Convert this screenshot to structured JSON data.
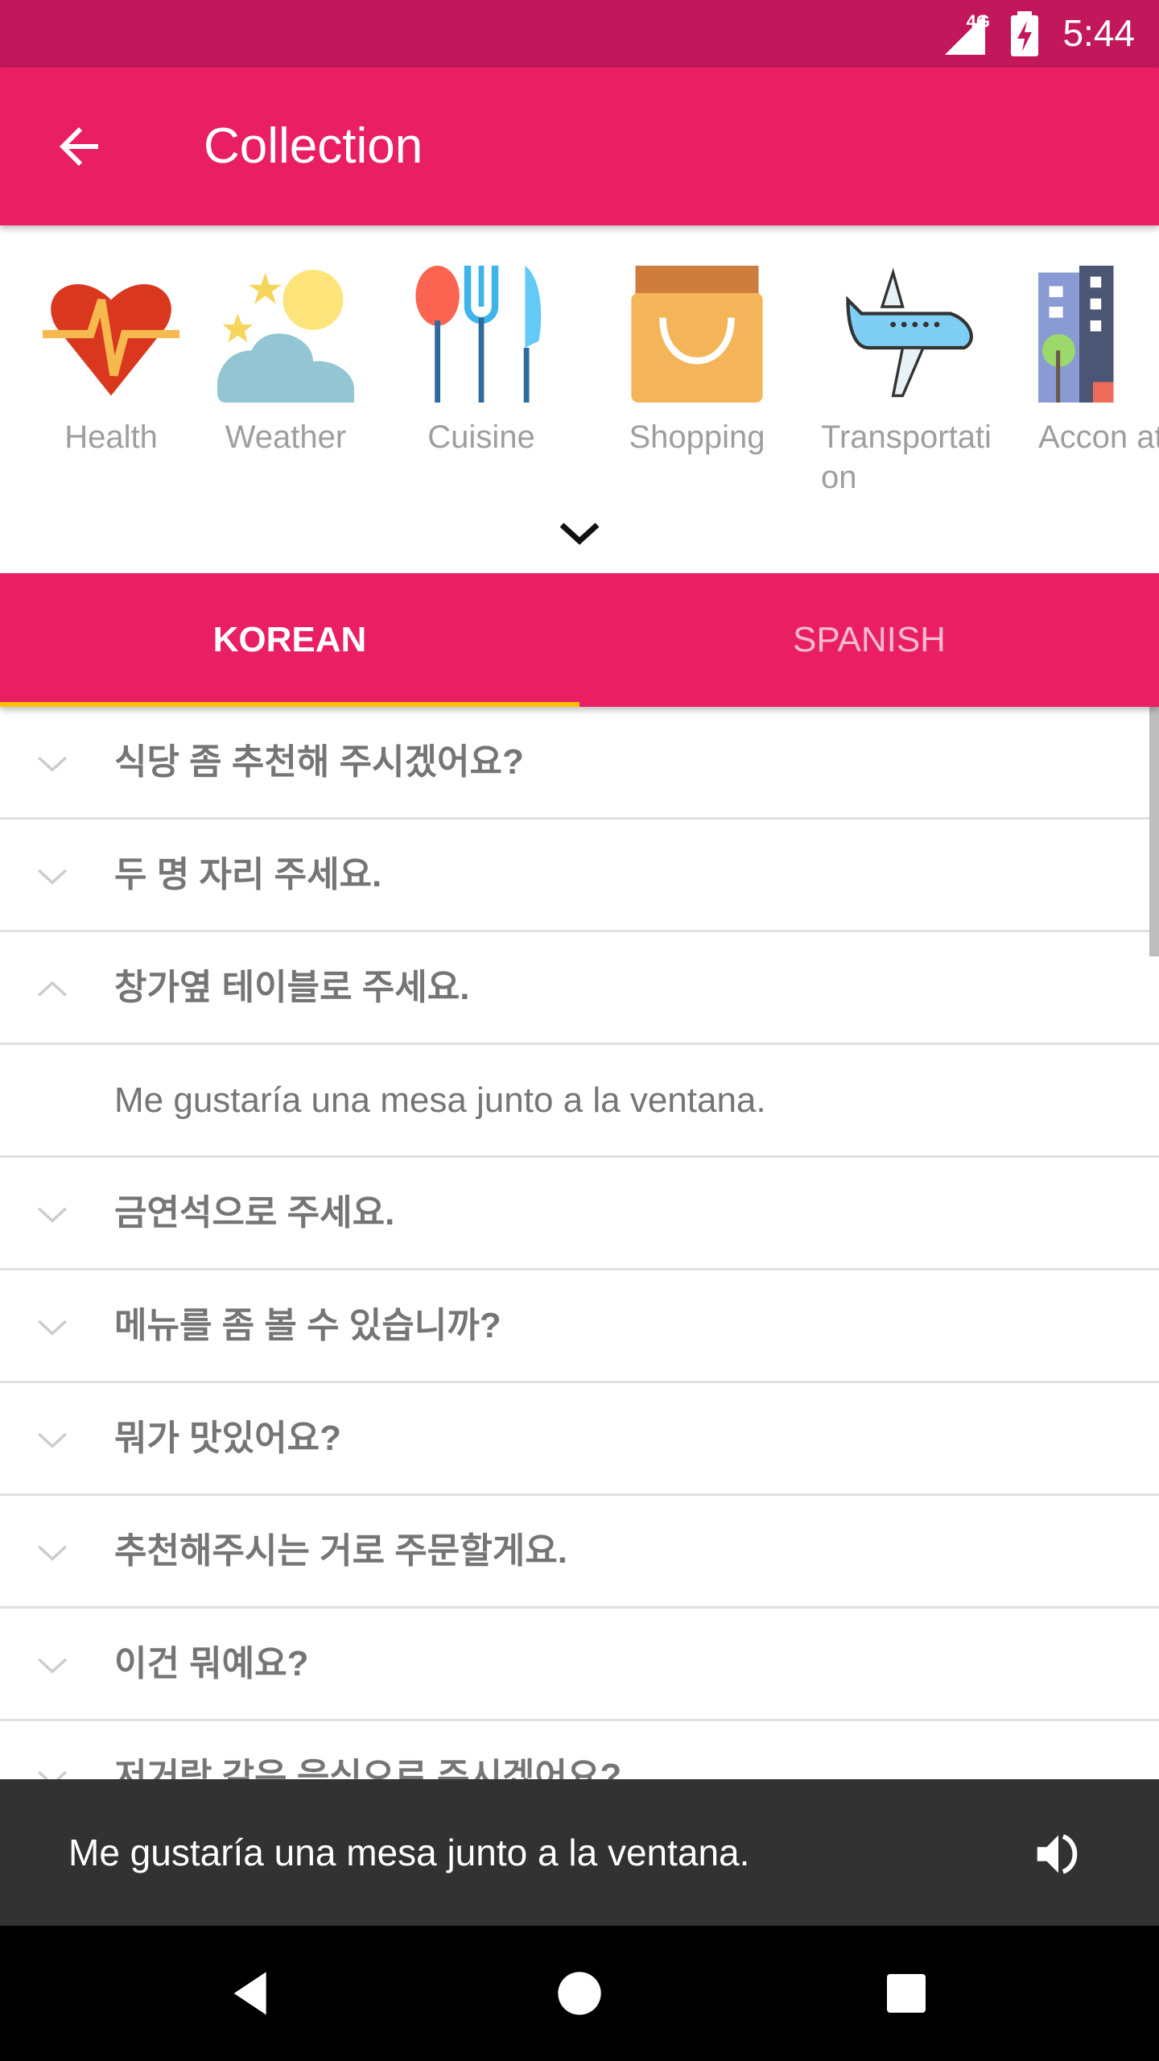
{
  "status_bar": {
    "network": "4G",
    "time": "5:44",
    "color": "#C2185B"
  },
  "toolbar": {
    "title": "Collection",
    "back_icon": "arrow-left-icon",
    "color": "#E91E63"
  },
  "categories": [
    {
      "label": "Health",
      "icon": "heart-pulse-icon"
    },
    {
      "label": "Weather",
      "icon": "sun-cloud-icon"
    },
    {
      "label": "Cuisine",
      "icon": "cutlery-icon"
    },
    {
      "label": "Shopping",
      "icon": "shopping-bag-icon"
    },
    {
      "label": "Transportation",
      "icon": "airplane-icon"
    },
    {
      "label": "Accommodation",
      "icon": "building-icon"
    }
  ],
  "category_labels_visible": {
    "transport": "Transportati on",
    "accommodation": "Accon ation"
  },
  "tabs": [
    {
      "label": "KOREAN",
      "selected": true
    },
    {
      "label": "SPANISH",
      "selected": false
    }
  ],
  "indicator_color": "#FFC107",
  "phrases": [
    {
      "text": "식당 좀 추천해 주시겠어요?",
      "expanded": false
    },
    {
      "text": "두 명 자리 주세요.",
      "expanded": false
    },
    {
      "text": "창가옆 테이블로 주세요.",
      "expanded": true,
      "translation": "Me gustaría una mesa junto a la ventana."
    },
    {
      "text": "금연석으로 주세요.",
      "expanded": false
    },
    {
      "text": "메뉴를 좀 볼 수 있습니까?",
      "expanded": false
    },
    {
      "text": "뭐가 맛있어요?",
      "expanded": false
    },
    {
      "text": "추천해주시는 거로 주문할게요.",
      "expanded": false
    },
    {
      "text": "이건 뭐예요?",
      "expanded": false
    },
    {
      "text": "저거랑 같은 음식으로 주시겠어요?",
      "expanded": false
    }
  ],
  "snackbar": {
    "message": "Me gustaría una mesa junto a la ventana.",
    "icon": "speaker-icon"
  },
  "nav_bar": {
    "back": "back-triangle-icon",
    "home": "home-circle-icon",
    "recents": "recents-square-icon"
  }
}
